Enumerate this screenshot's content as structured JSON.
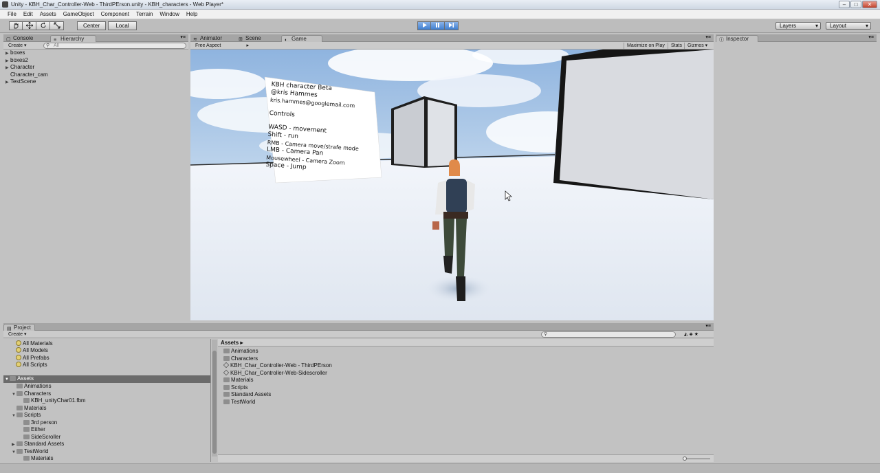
{
  "window": {
    "title": "Unity - KBH_Char_Controller-Web - ThirdPErson.unity - KBH_characters - Web Player*",
    "controls": [
      "–",
      "□",
      "✕"
    ]
  },
  "menu": [
    "File",
    "Edit",
    "Assets",
    "GameObject",
    "Component",
    "Terrain",
    "Window",
    "Help"
  ],
  "toolbar": {
    "transform_tools": [
      "hand-icon",
      "move-icon",
      "rotate-icon",
      "scale-icon"
    ],
    "pivot_mode": "Center",
    "pivot_rotation": "Local",
    "play_controls": [
      "play-icon",
      "pause-icon",
      "step-icon"
    ],
    "layers": "Layers",
    "layout": "Layout"
  },
  "hierarchy": {
    "tabs": [
      "Console",
      "Hierarchy"
    ],
    "create": "Create",
    "search_placeholder": "All",
    "items": [
      {
        "label": "boxes",
        "expandable": true
      },
      {
        "label": "boxes2",
        "expandable": true
      },
      {
        "label": "Character",
        "expandable": true
      },
      {
        "label": "Character_cam",
        "expandable": false
      },
      {
        "label": "TestScene",
        "expandable": true
      }
    ]
  },
  "center": {
    "tabs": [
      "Animator",
      "Scene",
      "Game"
    ],
    "aspect": "Free Aspect",
    "game_buttons": [
      "Maximize on Play",
      "Stats",
      "Gizmos"
    ]
  },
  "game_sign": {
    "lines": [
      "KBH character Beta",
      "@kris Hammes",
      "kris.hammes@googlemail.com",
      "",
      "Controls",
      "",
      "WASD - movement",
      "Shift - run",
      "RMB - Camera move/strafe mode",
      "LMB - Camera Pan",
      "Mousewheel - Camera Zoom",
      "Space - Jump"
    ]
  },
  "inspector": {
    "tab": "Inspector"
  },
  "project": {
    "tab": "Project",
    "create": "Create",
    "favorites": [
      "All Materials",
      "All Models",
      "All Prefabs",
      "All Scripts"
    ],
    "tree": [
      {
        "label": "Assets",
        "depth": 0,
        "expanded": true,
        "selected": true
      },
      {
        "label": "Animations",
        "depth": 1
      },
      {
        "label": "Characters",
        "depth": 1,
        "expanded": true
      },
      {
        "label": "KBH_unityChar01.fbm",
        "depth": 2
      },
      {
        "label": "Materials",
        "depth": 1
      },
      {
        "label": "Scripts",
        "depth": 1,
        "expanded": true
      },
      {
        "label": "3rd person",
        "depth": 2
      },
      {
        "label": "Either",
        "depth": 2
      },
      {
        "label": "SideScroller",
        "depth": 2
      },
      {
        "label": "Standard Assets",
        "depth": 1,
        "collapsed": true
      },
      {
        "label": "TestWorld",
        "depth": 1,
        "expanded": true
      },
      {
        "label": "Materials",
        "depth": 2
      }
    ],
    "breadcrumb": "Assets",
    "assets": [
      {
        "label": "Animations",
        "kind": "folder"
      },
      {
        "label": "Characters",
        "kind": "folder"
      },
      {
        "label": "KBH_Char_Controller-Web - ThirdPErson",
        "kind": "scene"
      },
      {
        "label": "KBH_Char_Controller-Web-Sidescroller",
        "kind": "scene"
      },
      {
        "label": "Materials",
        "kind": "folder"
      },
      {
        "label": "Scripts",
        "kind": "folder"
      },
      {
        "label": "Standard Assets",
        "kind": "folder"
      },
      {
        "label": "TestWorld",
        "kind": "folder"
      }
    ]
  },
  "colors": {
    "editor_bg": "#c2c2c2",
    "play_accent": "#3f7fd0",
    "selection": "#6b6b6b"
  }
}
